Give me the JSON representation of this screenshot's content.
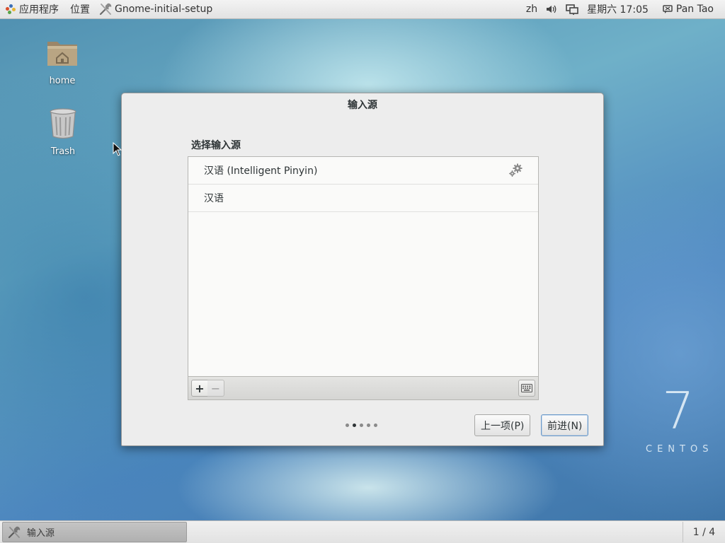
{
  "top_panel": {
    "applications_label": "应用程序",
    "places_label": "位置",
    "active_app_label": "Gnome-initial-setup",
    "input_method": "zh",
    "clock": "星期六 17:05",
    "user_name": "Pan Tao"
  },
  "desktop": {
    "icons": [
      {
        "label": "home",
        "icon": "home-folder-icon"
      },
      {
        "label": "Trash",
        "icon": "trash-icon"
      }
    ],
    "brand_number": "7",
    "brand_word": "CENTOS"
  },
  "dialog": {
    "title": "输入源",
    "section_label": "选择输入源",
    "input_sources": [
      {
        "label": "汉语 (Intelligent Pinyin)",
        "has_settings": true
      },
      {
        "label": "汉语",
        "has_settings": false
      }
    ],
    "toolbar": {
      "add_label": "+",
      "remove_label": "−"
    },
    "pager": {
      "total": 5,
      "current": 2
    },
    "prev_button": "上一项(P)",
    "next_button": "前进(N)"
  },
  "bottom_panel": {
    "task_label": "输入源",
    "workspace_indicator": "1 / 4"
  },
  "colors": {
    "panel_bg": "#e9e9e9",
    "dialog_bg": "#ededed",
    "list_bg": "#fafaf9",
    "focus_border": "#6c9ac9"
  }
}
